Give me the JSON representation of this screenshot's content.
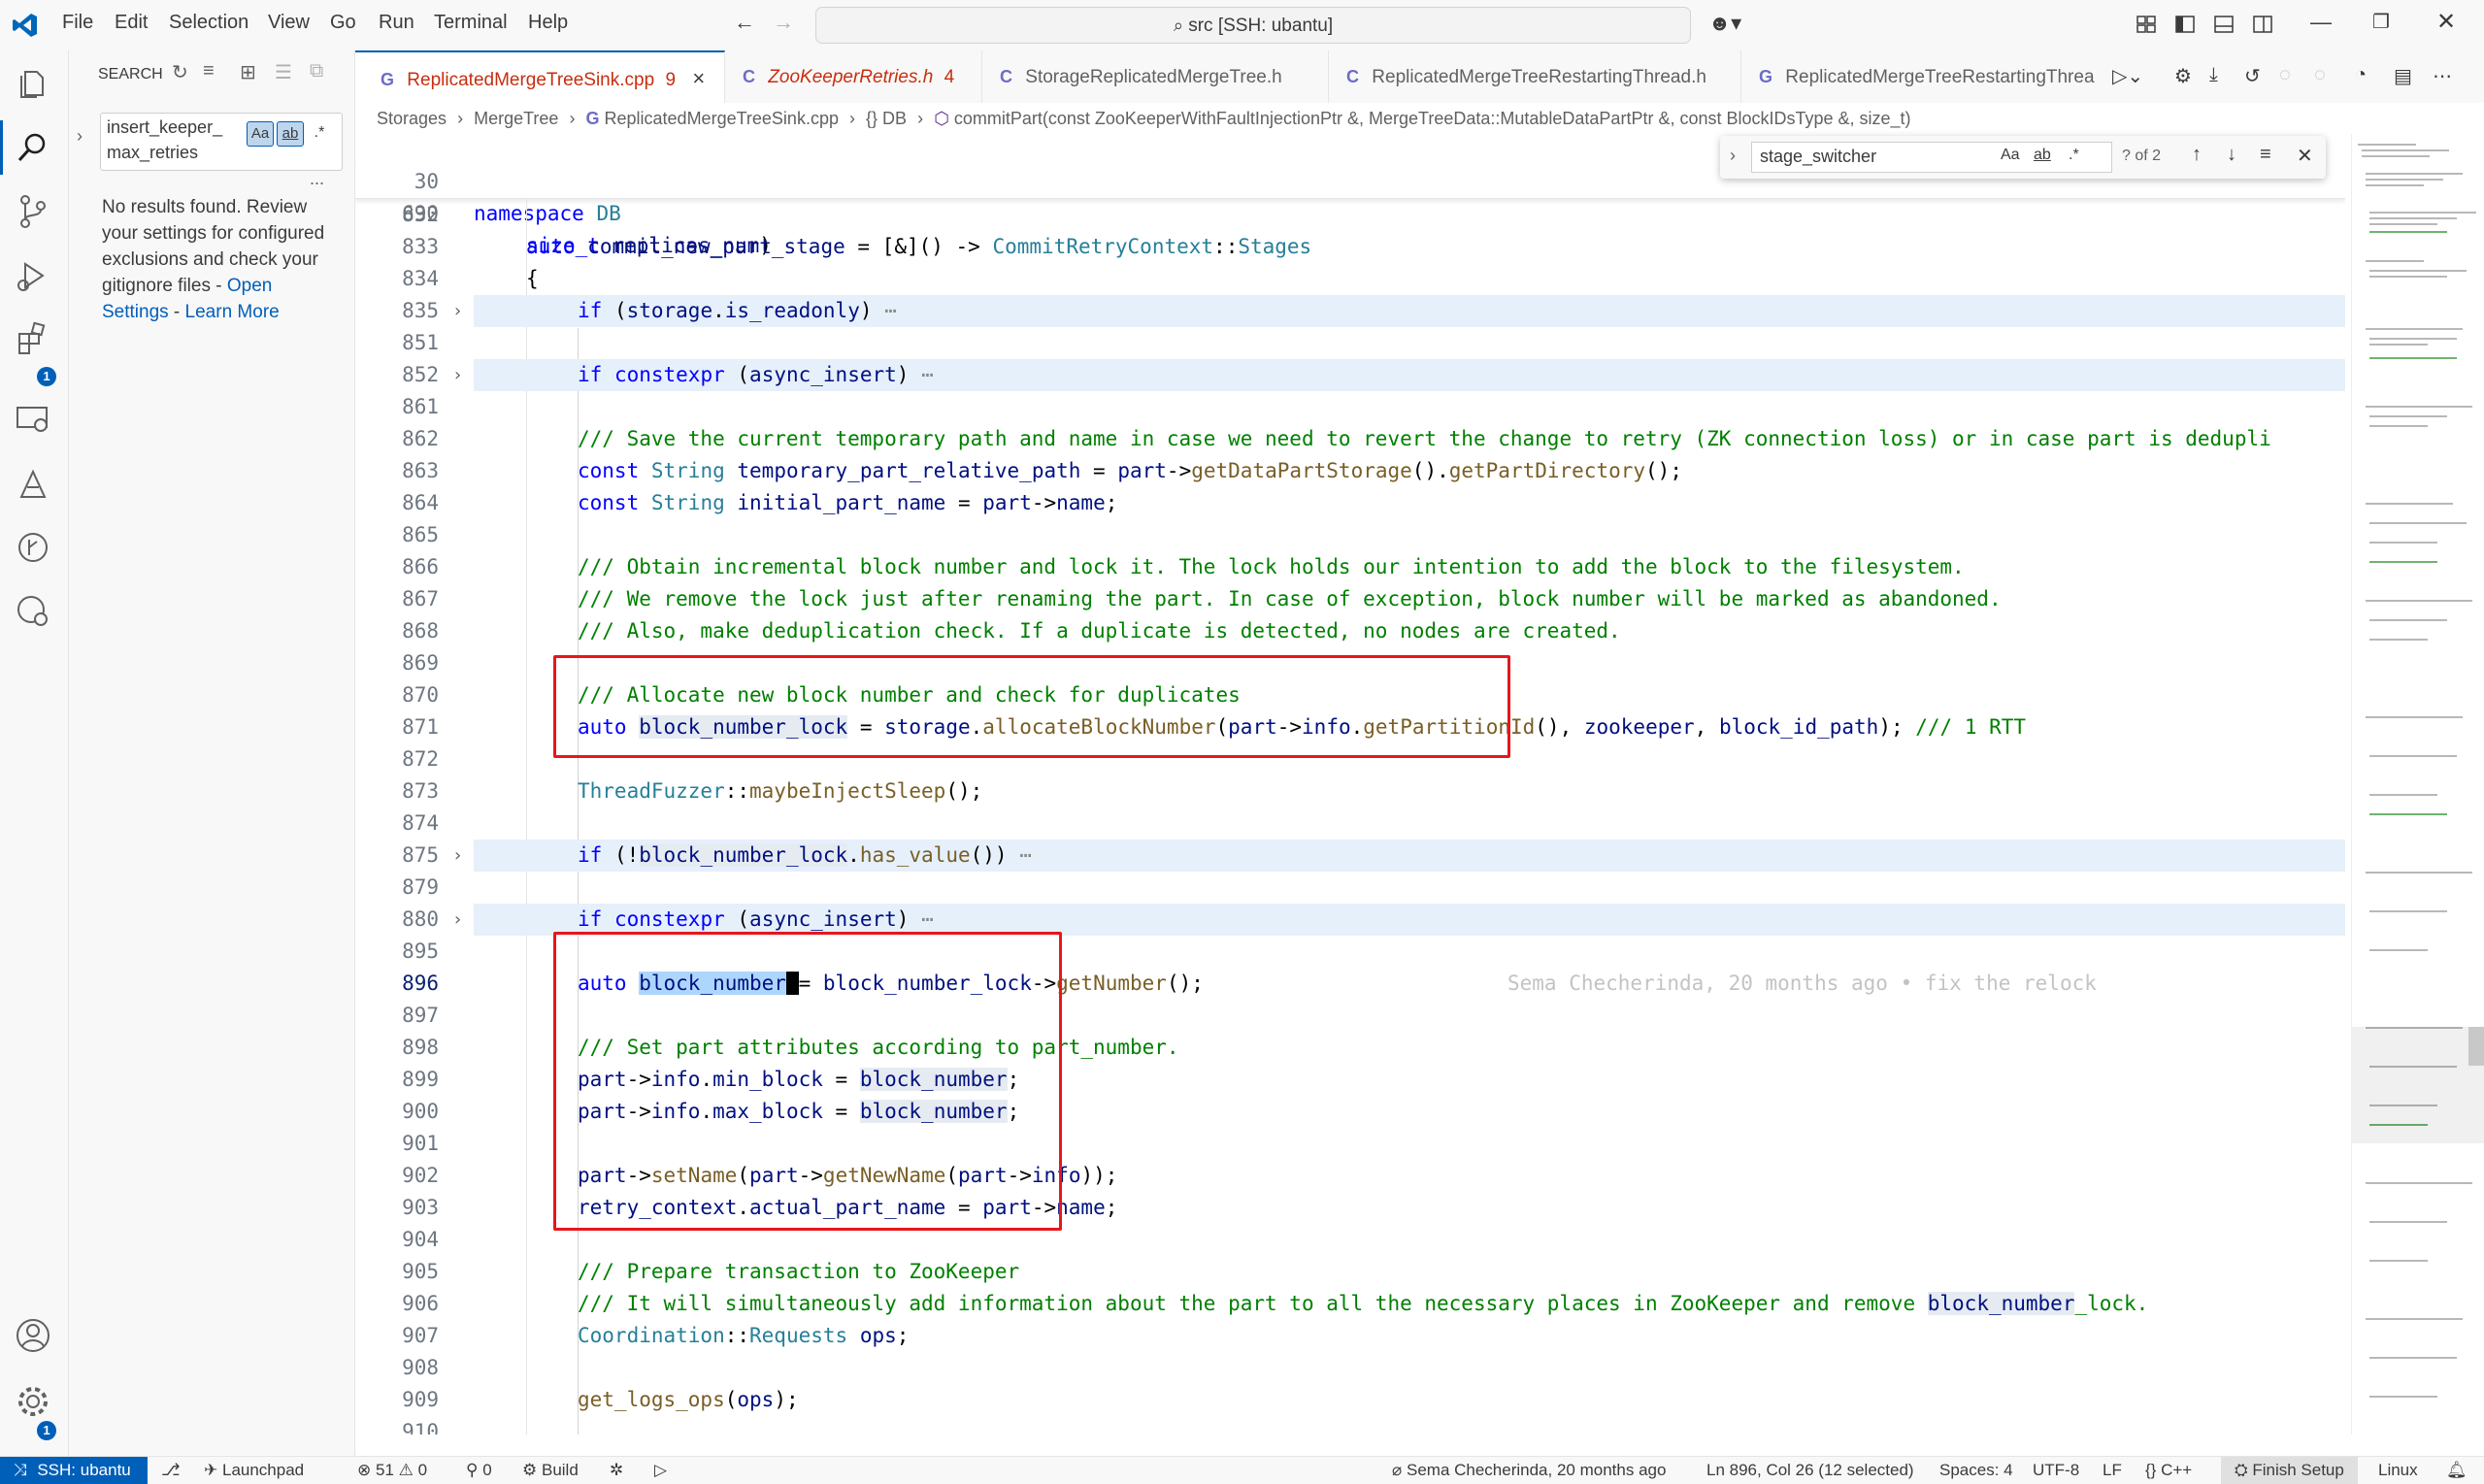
{
  "menu": [
    "File",
    "Edit",
    "Selection",
    "View",
    "Go",
    "Run",
    "Terminal",
    "Help"
  ],
  "command_center": "src [SSH: ubantu]",
  "activity_badges": {
    "extensions": "1",
    "manage": "1"
  },
  "sidebar": {
    "title": "SEARCH",
    "search_value_line1": "insert_keeper_",
    "search_value_line2": "max_retries",
    "opt_case": "Aa",
    "opt_word": "ab",
    "opt_regex": ".*",
    "more": "...",
    "no_results": "No results found. Review your settings for configured exclusions and check your gitignore files - ",
    "open_settings": "Open Settings",
    "sep": " - ",
    "learn_more": "Learn More"
  },
  "tabs": [
    {
      "icon": "G",
      "label": "ReplicatedMergeTreeSink.cpp",
      "badge": "9",
      "close": "×"
    },
    {
      "icon": "C",
      "label": "ZooKeeperRetries.h",
      "badge": "4"
    },
    {
      "icon": "C",
      "label": "StorageReplicatedMergeTree.h",
      "badge": ""
    },
    {
      "icon": "C",
      "label": "ReplicatedMergeTreeRestartingThread.h",
      "badge": ""
    },
    {
      "icon": "G",
      "label": "ReplicatedMergeTreeRestartingThrea",
      "badge": ""
    }
  ],
  "breadcrumb": {
    "p1": "Storages",
    "p2": "MergeTree",
    "p3": "ReplicatedMergeTreeSink.cpp",
    "p4": "DB",
    "p5": "commitPart(const ZooKeeperWithFaultInjectionPtr &, MergeTreeData::MutableDataPartPtr &, const BlockIDsType &, size_t)"
  },
  "find": {
    "value": "stage_switcher",
    "case": "Aa",
    "word": "ab",
    "regex": ".*",
    "count": "? of 2"
  },
  "sticky": [
    {
      "ln": "30",
      "text": "namespace DB"
    },
    {
      "ln": "690",
      "text": "size_t replicas_num)"
    }
  ],
  "lines": {
    "l832": "832",
    "l833": "833",
    "l834": "834",
    "l835": "835",
    "l851": "851",
    "l852": "852",
    "l861": "861",
    "l862": "862",
    "l863": "863",
    "l864": "864",
    "l865": "865",
    "l866": "866",
    "l867": "867",
    "l868": "868",
    "l869": "869",
    "l870": "870",
    "l871": "871",
    "l872": "872",
    "l873": "873",
    "l874": "874",
    "l875": "875",
    "l879": "879",
    "l880": "880",
    "l895": "895",
    "l896": "896",
    "l897": "897",
    "l898": "898",
    "l899": "899",
    "l900": "900",
    "l901": "901",
    "l902": "902",
    "l903": "903",
    "l904": "904",
    "l905": "905",
    "l906": "906",
    "l907": "907",
    "l908": "908",
    "l909": "909",
    "l910": "910"
  },
  "blame": "Sema Checherinda, 20 months ago • fix the relock",
  "status": {
    "remote": "SSH: ubantu",
    "launchpad": "Launchpad",
    "errors": "51",
    "warnings": "0",
    "ports": "0",
    "build": "Build",
    "author": "Sema Checherinda, 20 months ago",
    "position": "Ln 896, Col 26 (12 selected)",
    "spaces": "Spaces: 4",
    "encoding": "UTF-8",
    "eol": "LF",
    "lang": "C++",
    "finish": "Finish Setup",
    "os": "Linux"
  }
}
